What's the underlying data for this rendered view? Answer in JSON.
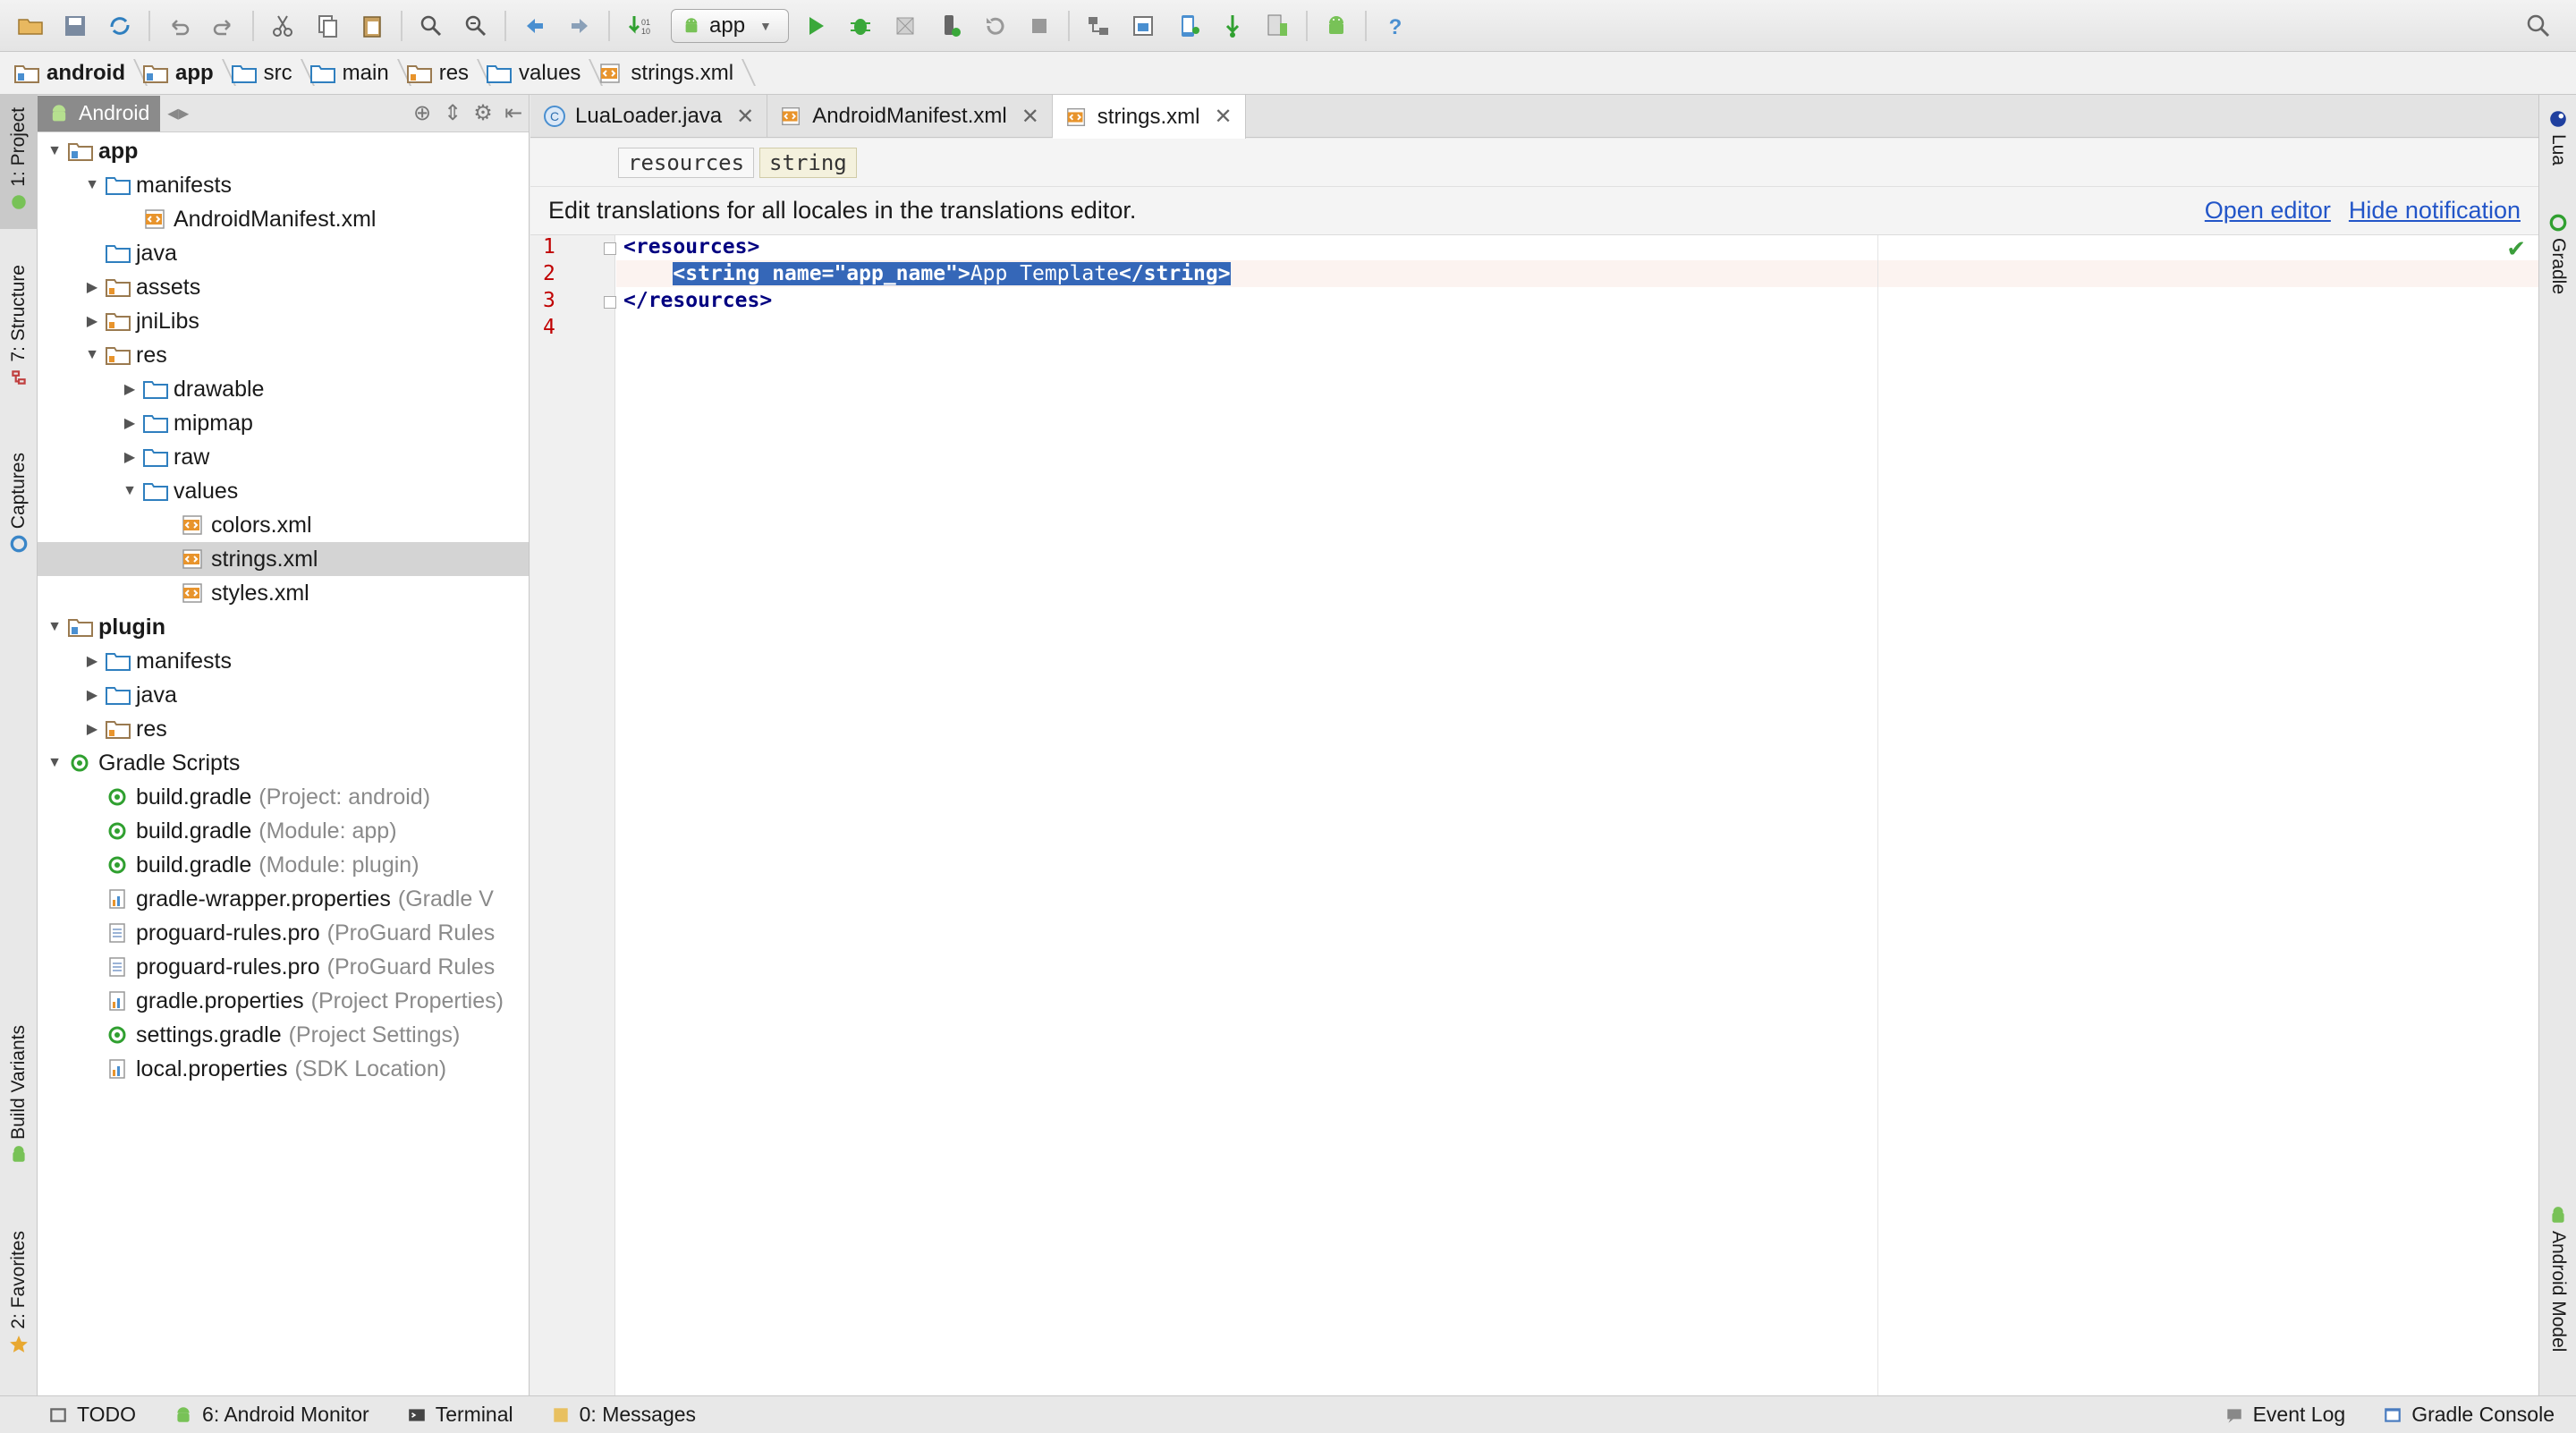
{
  "toolbar": {
    "run_config": "app",
    "icons": [
      "folder-open",
      "save-all",
      "sync",
      "undo",
      "redo",
      "cut",
      "copy",
      "paste",
      "find",
      "replace",
      "back",
      "forward",
      "make",
      "run",
      "debug",
      "coverage",
      "attach-debugger",
      "rerun",
      "stop",
      "project-structure",
      "sdk-manager",
      "avd-manager",
      "gradle-sync",
      "device-monitor",
      "android",
      "help",
      "search-everywhere"
    ]
  },
  "breadcrumb": [
    "android",
    "app",
    "src",
    "main",
    "res",
    "values",
    "strings.xml"
  ],
  "left_tabs": [
    "1: Project",
    "7: Structure",
    "Captures",
    "Build Variants",
    "2: Favorites"
  ],
  "right_tabs": [
    "Lua",
    "Gradle",
    "Android Model"
  ],
  "project_panel": {
    "view": "Android",
    "tree": [
      {
        "name": "app",
        "level": 0,
        "arrow": "down",
        "icon": "module",
        "bold": true
      },
      {
        "name": "manifests",
        "level": 1,
        "arrow": "down",
        "icon": "folder"
      },
      {
        "name": "AndroidManifest.xml",
        "level": 2,
        "arrow": "",
        "icon": "xml"
      },
      {
        "name": "java",
        "level": 1,
        "arrow": "",
        "icon": "folder"
      },
      {
        "name": "assets",
        "level": 1,
        "arrow": "right",
        "icon": "resfolder"
      },
      {
        "name": "jniLibs",
        "level": 1,
        "arrow": "right",
        "icon": "resfolder"
      },
      {
        "name": "res",
        "level": 1,
        "arrow": "down",
        "icon": "resfolder"
      },
      {
        "name": "drawable",
        "level": 2,
        "arrow": "right",
        "icon": "folder"
      },
      {
        "name": "mipmap",
        "level": 2,
        "arrow": "right",
        "icon": "folder"
      },
      {
        "name": "raw",
        "level": 2,
        "arrow": "right",
        "icon": "folder"
      },
      {
        "name": "values",
        "level": 2,
        "arrow": "down",
        "icon": "folder"
      },
      {
        "name": "colors.xml",
        "level": 3,
        "arrow": "",
        "icon": "xml"
      },
      {
        "name": "strings.xml",
        "level": 3,
        "arrow": "",
        "icon": "xml",
        "selected": true
      },
      {
        "name": "styles.xml",
        "level": 3,
        "arrow": "",
        "icon": "xml"
      },
      {
        "name": "plugin",
        "level": 0,
        "arrow": "down",
        "icon": "module",
        "bold": true
      },
      {
        "name": "manifests",
        "level": 1,
        "arrow": "right",
        "icon": "folder"
      },
      {
        "name": "java",
        "level": 1,
        "arrow": "right",
        "icon": "folder"
      },
      {
        "name": "res",
        "level": 1,
        "arrow": "right",
        "icon": "resfolder"
      },
      {
        "name": "Gradle Scripts",
        "level": 0,
        "arrow": "down",
        "icon": "gradle"
      },
      {
        "name": "build.gradle",
        "hint": "(Project: android)",
        "level": 1,
        "arrow": "",
        "icon": "gradle"
      },
      {
        "name": "build.gradle",
        "hint": "(Module: app)",
        "level": 1,
        "arrow": "",
        "icon": "gradle"
      },
      {
        "name": "build.gradle",
        "hint": "(Module: plugin)",
        "level": 1,
        "arrow": "",
        "icon": "gradle"
      },
      {
        "name": "gradle-wrapper.properties",
        "hint": "(Gradle V",
        "level": 1,
        "arrow": "",
        "icon": "props"
      },
      {
        "name": "proguard-rules.pro",
        "hint": "(ProGuard Rules",
        "level": 1,
        "arrow": "",
        "icon": "text"
      },
      {
        "name": "proguard-rules.pro",
        "hint": "(ProGuard Rules",
        "level": 1,
        "arrow": "",
        "icon": "text"
      },
      {
        "name": "gradle.properties",
        "hint": "(Project Properties)",
        "level": 1,
        "arrow": "",
        "icon": "props"
      },
      {
        "name": "settings.gradle",
        "hint": "(Project Settings)",
        "level": 1,
        "arrow": "",
        "icon": "gradle"
      },
      {
        "name": "local.properties",
        "hint": "(SDK Location)",
        "level": 1,
        "arrow": "",
        "icon": "props"
      }
    ]
  },
  "editor_tabs": [
    {
      "label": "LuaLoader.java",
      "icon": "java",
      "active": false
    },
    {
      "label": "AndroidManifest.xml",
      "icon": "xml",
      "active": false
    },
    {
      "label": "strings.xml",
      "icon": "xml",
      "active": true
    }
  ],
  "tag_breadcrumb": [
    "resources",
    "string"
  ],
  "notification": {
    "text": "Edit translations for all locales in the translations editor.",
    "open_editor": "Open editor",
    "hide": "Hide notification"
  },
  "code": {
    "line_numbers": [
      "1",
      "2",
      "3",
      "4"
    ],
    "line1": "<resources>",
    "line2_open": "<string",
    "line2_attr": "name=",
    "line2_val": "\"app_name\"",
    "line2_gt": ">",
    "line2_text": "App Template",
    "line2_close": "</string>",
    "line3": "</resources>"
  },
  "status_bar": {
    "todo": "TODO",
    "android_monitor": "6: Android Monitor",
    "terminal": "Terminal",
    "messages": "0: Messages",
    "event_log": "Event Log",
    "gradle_console": "Gradle Console"
  },
  "colors": {
    "selection": "#3567b8",
    "link": "#2255c8",
    "folder": "#2f7fbf",
    "android_green": "#78c257",
    "xml_orange": "#e8942c",
    "gradle_green": "#30a030"
  }
}
